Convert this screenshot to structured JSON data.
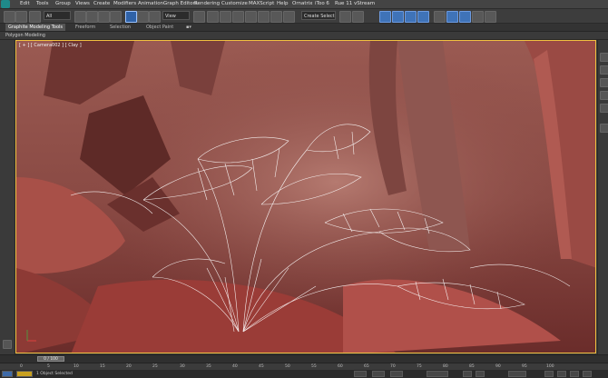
{
  "menubar": {
    "items": [
      "Edit",
      "Tools",
      "Group",
      "Views",
      "Create",
      "Modifiers",
      "Animation",
      "Graph Editors",
      "Rendering",
      "Customize",
      "MAXScript",
      "Help",
      "Ornatrix",
      "iToo 6",
      "Rue 11 vStream"
    ]
  },
  "toolbar": {
    "filter_value": "All",
    "coord_value": "View",
    "selection_set_placeholder": "Create Selection S"
  },
  "ribbon": {
    "tabs": [
      "Graphite Modeling Tools",
      "Freeform",
      "Selection",
      "Object Paint"
    ],
    "sub_label": "Polygon Modeling"
  },
  "viewport": {
    "label": "[ + ] [ Camera002 ] [ Clay ]"
  },
  "timeline": {
    "slider_label": "0 / 100"
  },
  "ruler": {
    "ticks": [
      "0",
      "5",
      "10",
      "15",
      "20",
      "25",
      "30",
      "35",
      "40",
      "45",
      "50",
      "55",
      "60",
      "65",
      "70",
      "75",
      "80",
      "85",
      "90",
      "95",
      "100"
    ]
  },
  "status": {
    "text": "1 Object Selected"
  },
  "colors": {
    "viewport_bg": "#7a3c38",
    "active_border": "#f0c040",
    "wire": "#ffffff"
  }
}
